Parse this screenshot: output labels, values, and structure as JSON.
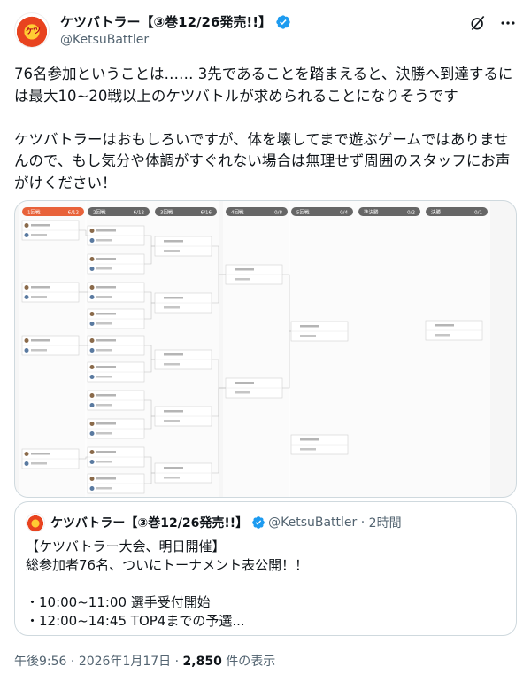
{
  "author": {
    "display_name": "ケツバトラー【③巻12/26発売!!】",
    "handle": "@KetsuBattler",
    "avatar_text": "ケツ"
  },
  "tweet": {
    "text": "76名参加ということは…… 3先であることを踏まえると、決勝へ到達するには最大10~20戦以上のケツバトルが求められることになりそうです\n\nケツバトラーはおもしろいですが、体を壊してまで遊ぶゲームではありませんので、もし気分や体調がすぐれない場合は無理せず周囲のスタッフにお声がけください！"
  },
  "media": {
    "rounds": [
      {
        "label": "1回戦",
        "count": "6/12"
      },
      {
        "label": "2回戦",
        "count": "6/12"
      },
      {
        "label": "3回戦",
        "count": "6/16"
      },
      {
        "label": "4回戦",
        "count": "0/8"
      },
      {
        "label": "5回戦",
        "count": "0/4"
      },
      {
        "label": "準決勝",
        "count": "0/2"
      },
      {
        "label": "決勝",
        "count": "0/1"
      }
    ]
  },
  "quote": {
    "display_name": "ケツバトラー【③巻12/26発売!!】",
    "handle": "@KetsuBattler",
    "time": "2時間",
    "text": "【ケツバトラー大会、明日開催】\n総参加者76名、ついにトーナメント表公開！！\n\n・10:00~11:00 選手受付開始\n・12:00~14:45 TOP4までの予選..."
  },
  "meta": {
    "time": "午後9:56",
    "date": "2026年1月17日",
    "views_count": "2,850",
    "views_label": "件の表示"
  },
  "colors": {
    "accent": "#1d9bf0",
    "round_header_first": "#e8623a",
    "round_header": "#666666"
  }
}
